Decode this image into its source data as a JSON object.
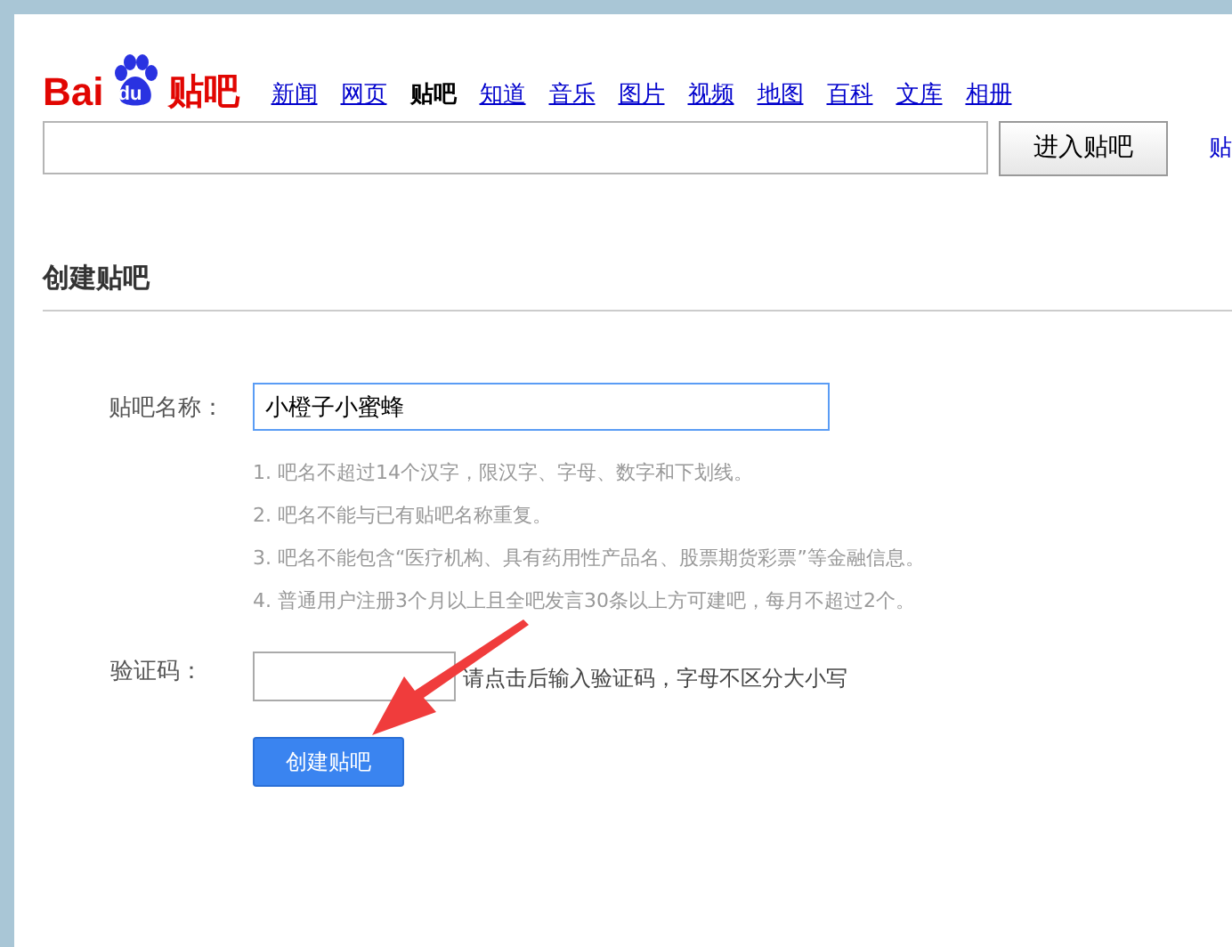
{
  "logo": {
    "left": "Bai",
    "badge": "du",
    "right": "贴吧"
  },
  "nav": [
    {
      "label": "新闻",
      "selected": false
    },
    {
      "label": "网页",
      "selected": false
    },
    {
      "label": "贴吧",
      "selected": true
    },
    {
      "label": "知道",
      "selected": false
    },
    {
      "label": "音乐",
      "selected": false
    },
    {
      "label": "图片",
      "selected": false
    },
    {
      "label": "视频",
      "selected": false
    },
    {
      "label": "地图",
      "selected": false
    },
    {
      "label": "百科",
      "selected": false
    },
    {
      "label": "文库",
      "selected": false
    },
    {
      "label": "相册",
      "selected": false
    }
  ],
  "search": {
    "button": "进入贴吧",
    "side_link": "贴"
  },
  "section_title": "创建贴吧",
  "name_field": {
    "label": "贴吧名称：",
    "value": "小橙子小蜜蜂"
  },
  "rules": [
    "1. 吧名不超过14个汉字，限汉字、字母、数字和下划线。",
    "2. 吧名不能与已有贴吧名称重复。",
    "3. 吧名不能包含“医疗机构、具有药用性产品名、股票期货彩票”等金融信息。",
    "4. 普通用户注册3个月以上且全吧发言30条以上方可建吧，每月不超过2个。"
  ],
  "captcha": {
    "label": "验证码：",
    "hint": "请点击后输入验证码，字母不区分大小写"
  },
  "submit": "创建贴吧"
}
